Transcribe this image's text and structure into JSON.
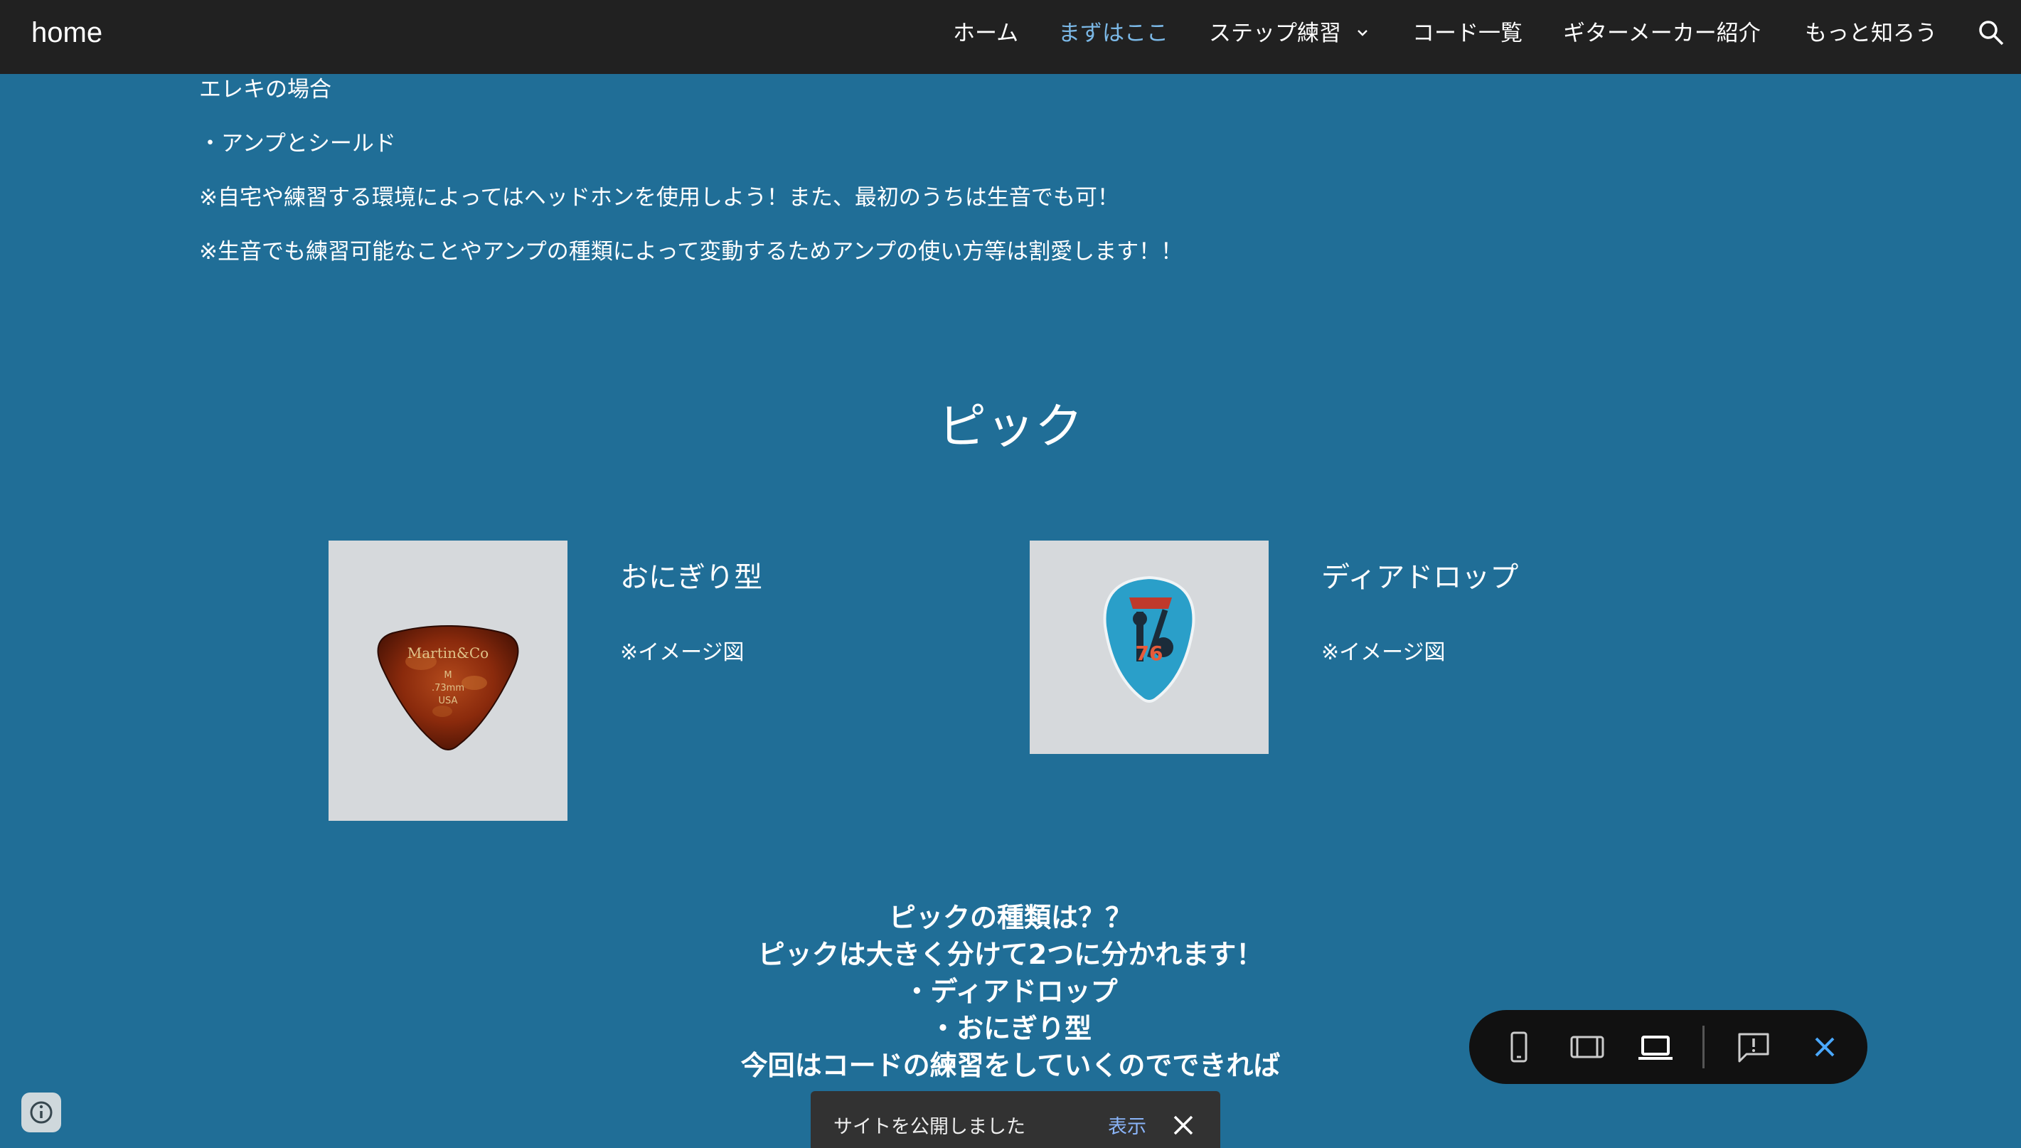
{
  "header": {
    "site_title": "home",
    "nav": [
      {
        "label": "ホーム",
        "active": false
      },
      {
        "label": "まずはここ",
        "active": true
      },
      {
        "label": "ステップ練習",
        "active": false,
        "has_dropdown": true
      },
      {
        "label": "コード一覧",
        "active": false
      },
      {
        "label": "ギターメーカー紹介",
        "active": false
      },
      {
        "label": "もっと知ろう",
        "active": false
      }
    ],
    "search_icon": "search-icon"
  },
  "content": {
    "paragraphs": [
      "エレキの場合",
      "・アンプとシールド",
      "※自宅や練習する環境によってはヘッドホンを使用しよう！また、最初のうちは生音でも可！",
      "※生音でも練習可能なことやアンプの種類によって変動するためアンプの使い方等は割愛します！！"
    ],
    "section_title": "ピック",
    "cards": [
      {
        "title": "おにぎり型",
        "note": "※イメージ図",
        "pick_text": [
          "Martin&Co",
          "M",
          ".73mm",
          "USA"
        ]
      },
      {
        "title": "ディアドロップ",
        "note": "※イメージ図",
        "pick_text": [
          "76"
        ]
      }
    ],
    "center_lines": [
      "ピックの種類は？？",
      "ピックは大きく分けて2つに分かれます！",
      "・ディアドロップ",
      "・おにぎり型",
      "今回はコードの練習をしていくのでできれば"
    ]
  },
  "preview_toolbar": {
    "buttons": [
      "phone-view-icon",
      "tablet-view-icon",
      "laptop-view-icon",
      "feedback-icon",
      "close-icon"
    ]
  },
  "toast": {
    "message": "サイトを公開しました",
    "action": "表示"
  },
  "colors": {
    "background": "#206e97",
    "topbar": "#212121",
    "nav_active": "#7bb8e6",
    "toast_action": "#8ab4f8"
  }
}
